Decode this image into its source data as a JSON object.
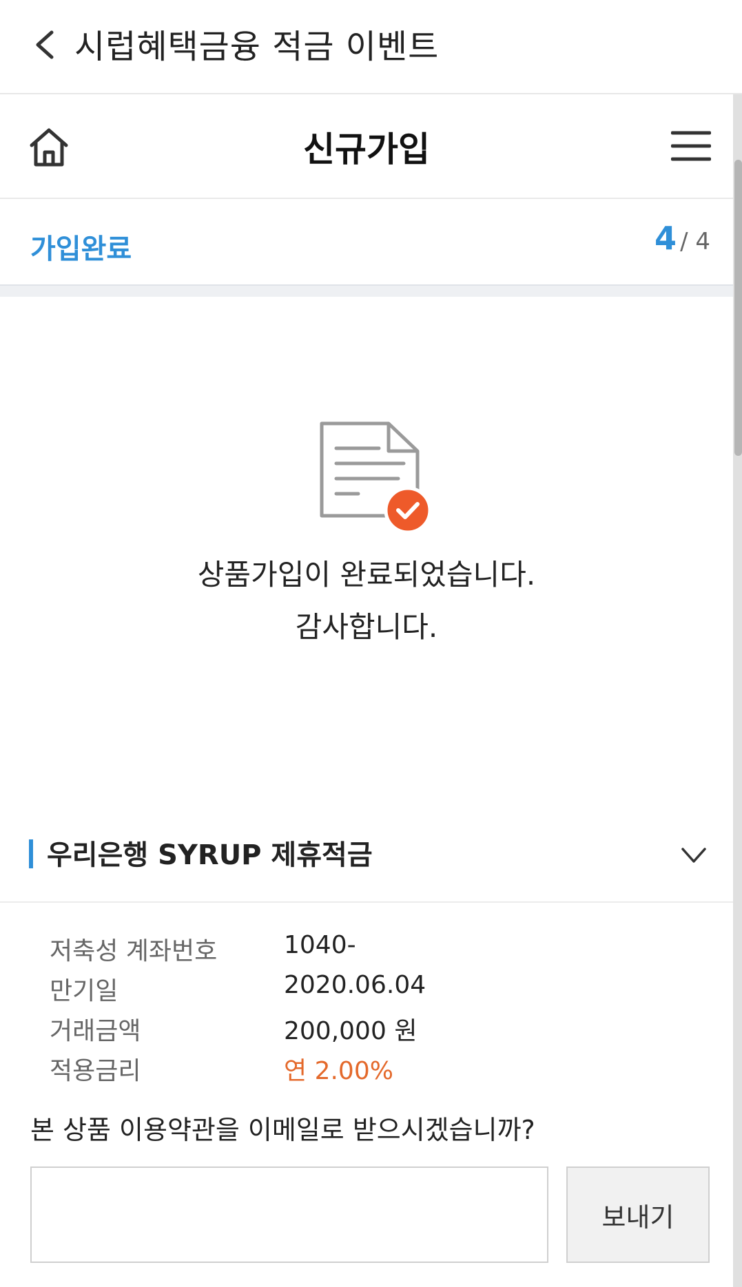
{
  "topbar": {
    "title": "시럽혜택금융 적금 이벤트"
  },
  "header": {
    "title": "신규가입"
  },
  "step": {
    "name": "가입완료",
    "current": "4",
    "total": "/ 4"
  },
  "message": {
    "line1": "상품가입이 완료되었습니다.",
    "line2": "감사합니다."
  },
  "product": {
    "name": "우리은행 SYRUP 제휴적금"
  },
  "details": [
    {
      "label": "저축성 계좌번호",
      "value": "1040-"
    },
    {
      "label": "만기일",
      "value": "2020.06.04"
    },
    {
      "label": "거래금액",
      "value": "200,000 원"
    },
    {
      "label": "적용금리",
      "value": "연 2.00%"
    }
  ],
  "email": {
    "question": "본 상품 이용약관을 이메일로 받으시겠습니까?",
    "value": "",
    "send_label": "보내기"
  },
  "colors": {
    "accent": "#2f8fd8",
    "rate": "#e4692b",
    "check_badge": "#ee5a2a"
  }
}
